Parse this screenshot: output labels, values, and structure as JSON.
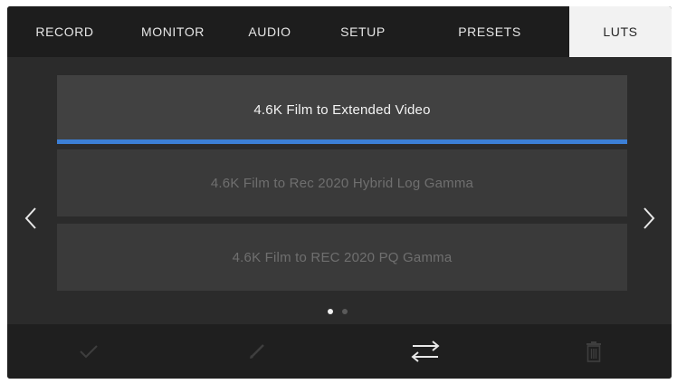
{
  "tabs": [
    {
      "label": "RECORD",
      "active": false
    },
    {
      "label": "MONITOR",
      "active": false
    },
    {
      "label": "AUDIO",
      "active": false
    },
    {
      "label": "SETUP",
      "active": false
    },
    {
      "label": "PRESETS",
      "active": false
    },
    {
      "label": "LUTS",
      "active": true
    }
  ],
  "luts": [
    {
      "label": "4.6K Film to Extended Video",
      "selected": true
    },
    {
      "label": "4.6K Film to Rec 2020 Hybrid Log Gamma",
      "selected": false
    },
    {
      "label": "4.6K Film to REC 2020 PQ Gamma",
      "selected": false
    }
  ],
  "pagination": {
    "current": 1,
    "total": 2
  },
  "toolbar": {
    "items": [
      {
        "name": "confirm-icon",
        "enabled": false
      },
      {
        "name": "edit-icon",
        "enabled": false
      },
      {
        "name": "transfer-icon",
        "enabled": true
      },
      {
        "name": "trash-icon",
        "enabled": false
      }
    ]
  },
  "colors": {
    "accent": "#3c7fd6",
    "tab_active_bg": "#f2f2f2",
    "background": "#2b2b2b"
  },
  "icons": {
    "prev": "chevron-left-icon",
    "next": "chevron-right-icon"
  }
}
